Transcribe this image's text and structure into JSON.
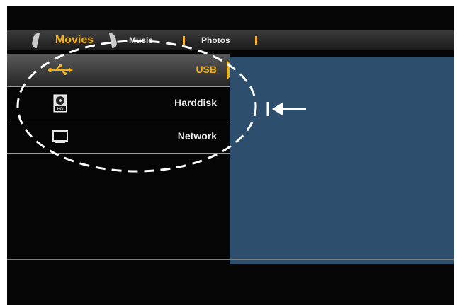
{
  "tabs": [
    {
      "label": "Movies",
      "active": true
    },
    {
      "label": "Music",
      "active": false
    },
    {
      "label": "Photos",
      "active": false
    }
  ],
  "menu": {
    "items": [
      {
        "label": "USB",
        "icon": "usb-icon",
        "selected": true
      },
      {
        "label": "Harddisk",
        "icon": "harddisk-icon",
        "selected": false
      },
      {
        "label": "Network",
        "icon": "network-icon",
        "selected": false
      }
    ]
  },
  "colors": {
    "accent": "#f3b01d",
    "preview_bg": "#2d4e6c",
    "screen_bg": "#050505"
  }
}
